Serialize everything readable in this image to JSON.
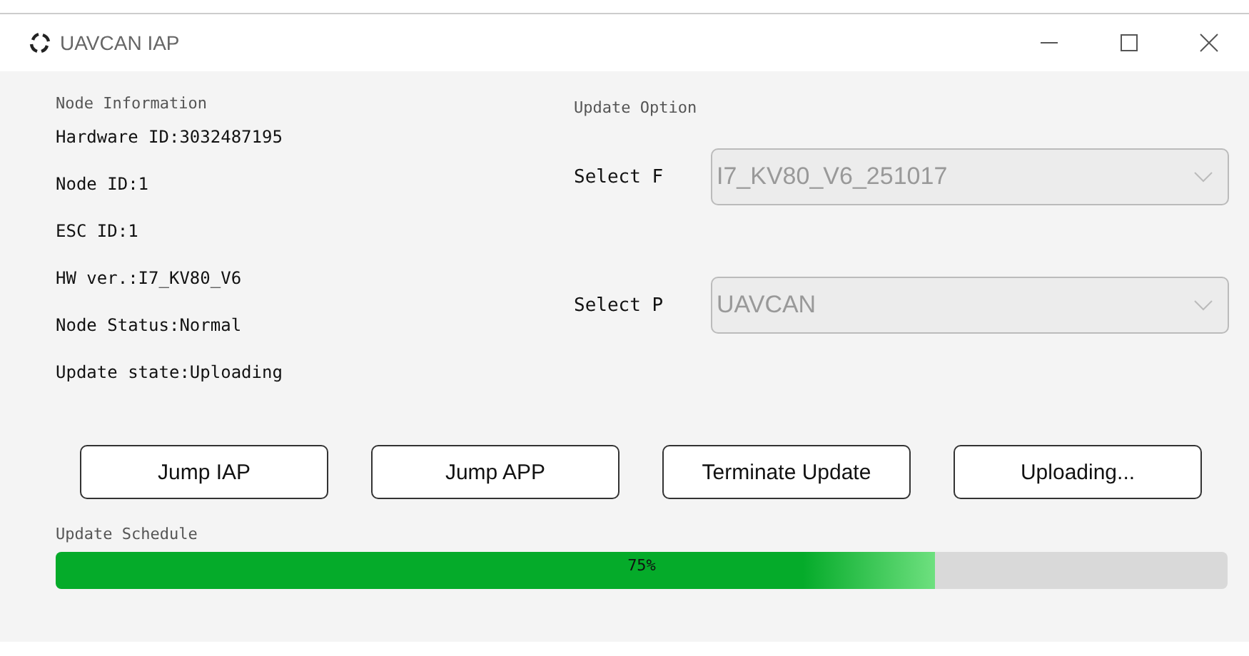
{
  "window": {
    "title": "UAVCAN IAP"
  },
  "node_info": {
    "title": "Node Information",
    "lines": [
      "Hardware ID:3032487195",
      "Node ID:1",
      "ESC ID:1",
      "HW ver.:I7_KV80_V6",
      "Node Status:Normal",
      "Update state:Uploading"
    ]
  },
  "update_option": {
    "title": "Update Option",
    "selects": [
      {
        "label": "Select F",
        "value": "I7_KV80_V6_251017",
        "disabled": true
      },
      {
        "label": "Select P",
        "value": "UAVCAN",
        "disabled": true
      }
    ]
  },
  "buttons": [
    "Jump IAP",
    "Jump APP",
    "Terminate Update",
    "Uploading..."
  ],
  "progress": {
    "label": "Update Schedule",
    "level": 0.75,
    "reading": "75%"
  }
}
